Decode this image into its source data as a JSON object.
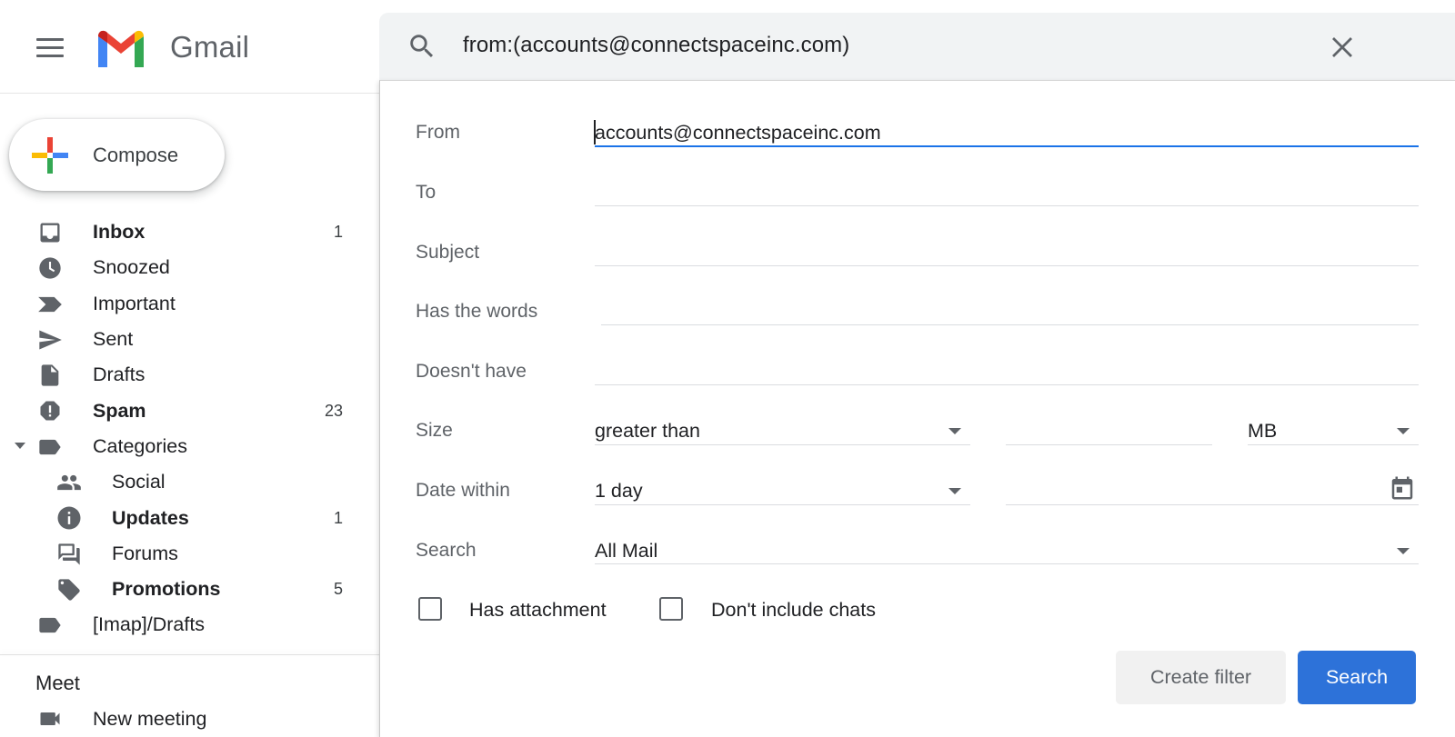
{
  "app": {
    "name": "Gmail"
  },
  "colors": {
    "accent": "#1a73e8",
    "search_button": "#2d72d9",
    "text": "#202124",
    "muted": "#5f6368"
  },
  "compose": {
    "label": "Compose"
  },
  "sidebar": {
    "items": [
      {
        "label": "Inbox",
        "count": "1",
        "icon": "inbox-icon",
        "bold": true
      },
      {
        "label": "Snoozed",
        "count": "",
        "icon": "clock-icon",
        "bold": false
      },
      {
        "label": "Important",
        "count": "",
        "icon": "important-icon",
        "bold": false
      },
      {
        "label": "Sent",
        "count": "",
        "icon": "send-icon",
        "bold": false
      },
      {
        "label": "Drafts",
        "count": "",
        "icon": "draft-icon",
        "bold": false
      },
      {
        "label": "Spam",
        "count": "23",
        "icon": "spam-icon",
        "bold": true
      },
      {
        "label": "Categories",
        "count": "",
        "icon": "label-icon",
        "bold": false
      },
      {
        "label": "Social",
        "count": "",
        "icon": "people-icon",
        "bold": false
      },
      {
        "label": "Updates",
        "count": "1",
        "icon": "info-icon",
        "bold": true
      },
      {
        "label": "Forums",
        "count": "",
        "icon": "forum-icon",
        "bold": false
      },
      {
        "label": "Promotions",
        "count": "5",
        "icon": "tag-icon",
        "bold": true
      },
      {
        "label": "[Imap]/Drafts",
        "count": "",
        "icon": "label-icon",
        "bold": false
      }
    ]
  },
  "meet": {
    "title": "Meet",
    "new_meeting": "New meeting"
  },
  "search": {
    "query": "from:(accounts@connectspaceinc.com)"
  },
  "advanced": {
    "from_label": "From",
    "from_value": "accounts@connectspaceinc.com",
    "to_label": "To",
    "to_value": "",
    "subject_label": "Subject",
    "subject_value": "",
    "has_words_label": "Has the words",
    "has_words_value": "",
    "doesnt_have_label": "Doesn't have",
    "doesnt_have_value": "",
    "size_label": "Size",
    "size_operator": "greater than",
    "size_value": "",
    "size_unit": "MB",
    "date_label": "Date within",
    "date_value": "1 day",
    "date_picker_value": "",
    "search_label": "Search",
    "search_value": "All Mail",
    "has_attachment_label": "Has attachment",
    "has_attachment_checked": false,
    "no_chats_label": "Don't include chats",
    "no_chats_checked": false,
    "create_filter_label": "Create filter",
    "search_button_label": "Search"
  }
}
